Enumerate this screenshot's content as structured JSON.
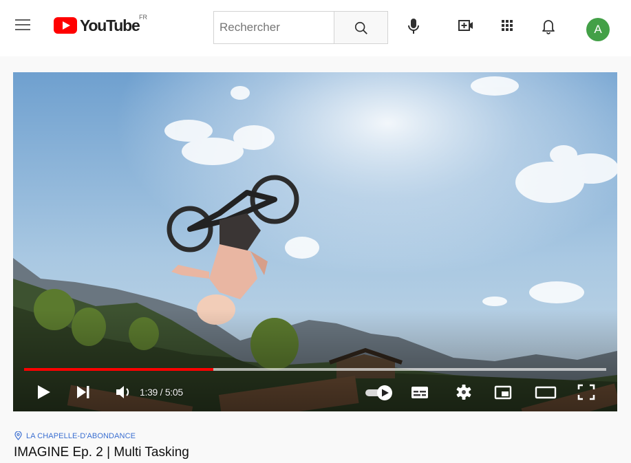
{
  "header": {
    "logo_text": "YouTube",
    "region_code": "FR",
    "search_placeholder": "Rechercher"
  },
  "icons": {
    "menu": "hamburger-menu-icon",
    "search": "magnifier-icon",
    "voice": "microphone-icon",
    "create": "video-plus-icon",
    "apps": "apps-grid-icon",
    "notifications": "bell-icon"
  },
  "user": {
    "avatar_initial": "A",
    "avatar_color": "#43a047"
  },
  "player": {
    "current_time": "1:39",
    "duration": "5:05",
    "time_display": "1:39 / 5:05",
    "progress_fraction": 0.325,
    "progress_color": "#ff0000",
    "autoplay_on": true
  },
  "video": {
    "location": "LA CHAPELLE-D'ABONDANCE",
    "title": "IMAGINE Ep. 2 | Multi Tasking"
  }
}
